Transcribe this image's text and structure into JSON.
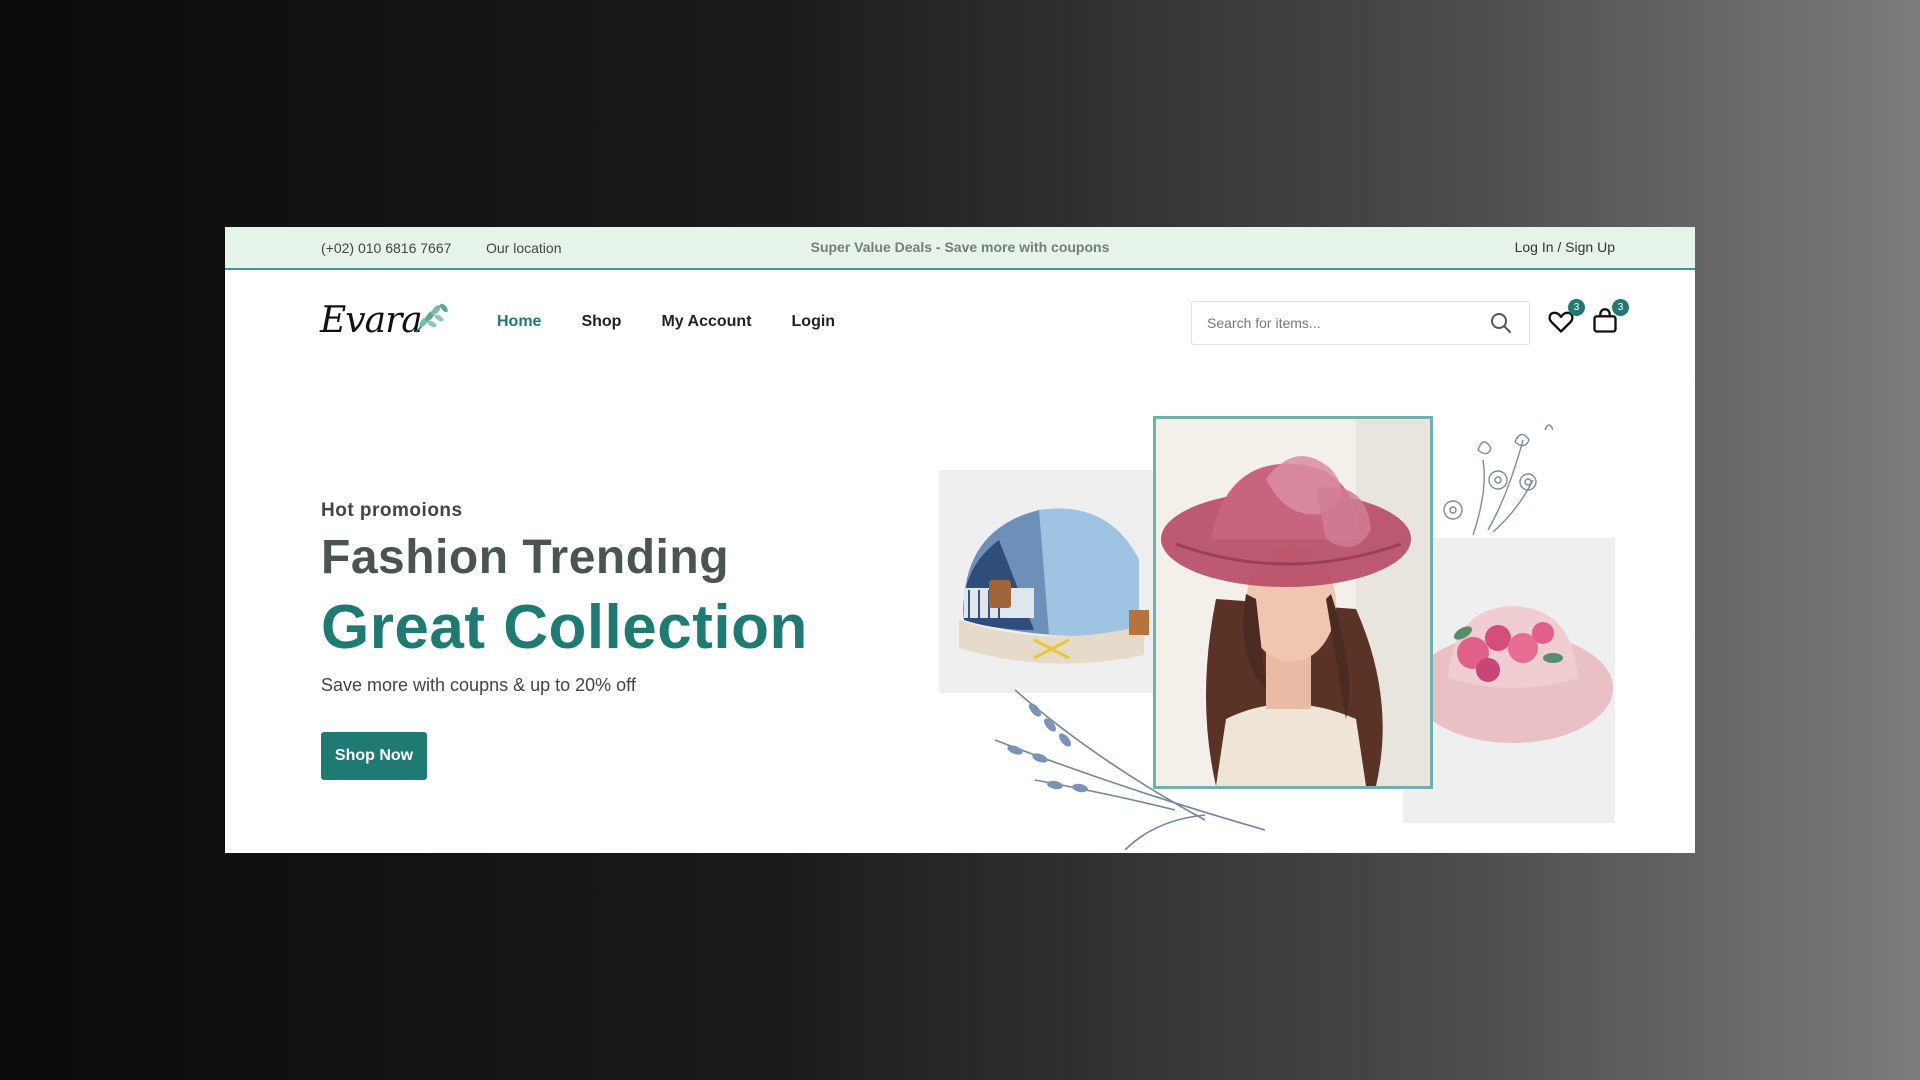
{
  "topbar": {
    "phone": "(+02) 010 6816 7667",
    "location": "Our location",
    "deal": "Super Value Deals - Save more with coupons",
    "auth": "Log In / Sign Up"
  },
  "header": {
    "logo": "Evara",
    "nav": [
      {
        "label": "Home",
        "active": true
      },
      {
        "label": "Shop",
        "active": false
      },
      {
        "label": "My Account",
        "active": false
      },
      {
        "label": "Login",
        "active": false
      }
    ],
    "search_placeholder": "Search for items...",
    "wishlist_count": "3",
    "cart_count": "3"
  },
  "hero": {
    "subtitle": "Hot promoions",
    "title_line1": "Fashion Trending",
    "title_line2": "Great Collection",
    "description": "Save more with coupns & up to 20% off",
    "cta_label": "Shop Now"
  },
  "colors": {
    "accent": "#1f7a73",
    "topbar_bg": "#e6f3ea",
    "heading": "#4a5551"
  },
  "icons": [
    "search-icon",
    "heart-icon",
    "shopping-bag-icon",
    "leaf-icon",
    "flower-sketch",
    "lavender-sketch"
  ]
}
